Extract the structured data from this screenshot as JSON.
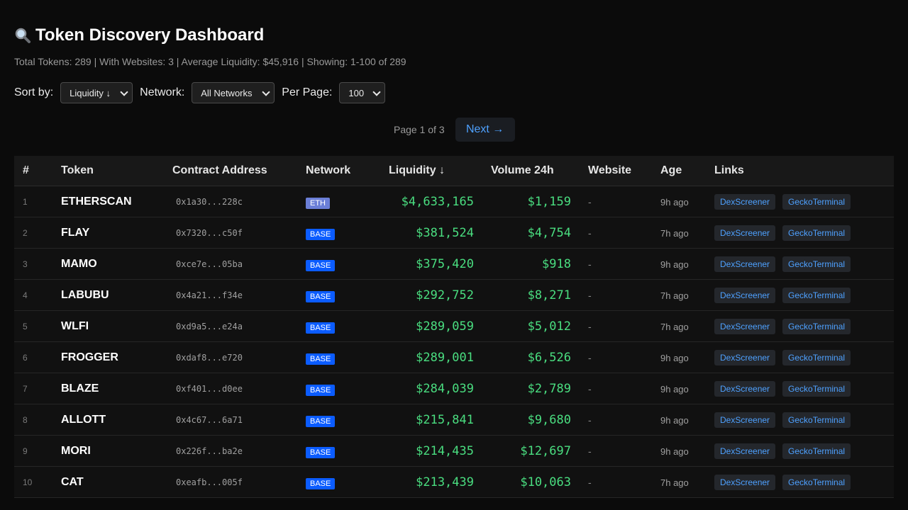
{
  "header": {
    "title": "Token Discovery Dashboard",
    "title_icon": "magnifier-icon",
    "stats": "Total Tokens: 289 | With Websites: 3 | Average Liquidity: $45,916 | Showing: 1-100 of 289"
  },
  "controls": {
    "sort_label": "Sort by:",
    "sort_value": "Liquidity ↓",
    "network_label": "Network:",
    "network_value": "All Networks",
    "per_page_label": "Per Page:",
    "per_page_value": "100"
  },
  "pagination": {
    "info": "Page 1 of 3",
    "next_label": "Next →"
  },
  "table": {
    "columns": [
      "#",
      "Token",
      "Contract Address",
      "Network",
      "Liquidity ↓",
      "Volume 24h",
      "Website",
      "Age",
      "Links"
    ],
    "link_labels": [
      "DexScreener",
      "GeckoTerminal"
    ],
    "colors": {
      "ETH": "#6b7fd7",
      "BASE": "#0b5cff",
      "positive": "#4ade80",
      "link": "#4ea1ff"
    },
    "rows": [
      {
        "num": "1",
        "token": "ETHERSCAN",
        "address": "0x1a30...228c",
        "network": "ETH",
        "liquidity": "$4,633,165",
        "volume": "$1,159",
        "website": "-",
        "age": "9h ago"
      },
      {
        "num": "2",
        "token": "FLAY",
        "address": "0x7320...c50f",
        "network": "BASE",
        "liquidity": "$381,524",
        "volume": "$4,754",
        "website": "-",
        "age": "7h ago"
      },
      {
        "num": "3",
        "token": "MAMO",
        "address": "0xce7e...05ba",
        "network": "BASE",
        "liquidity": "$375,420",
        "volume": "$918",
        "website": "-",
        "age": "9h ago"
      },
      {
        "num": "4",
        "token": "LABUBU",
        "address": "0x4a21...f34e",
        "network": "BASE",
        "liquidity": "$292,752",
        "volume": "$8,271",
        "website": "-",
        "age": "7h ago"
      },
      {
        "num": "5",
        "token": "WLFI",
        "address": "0xd9a5...e24a",
        "network": "BASE",
        "liquidity": "$289,059",
        "volume": "$5,012",
        "website": "-",
        "age": "7h ago"
      },
      {
        "num": "6",
        "token": "FROGGER",
        "address": "0xdaf8...e720",
        "network": "BASE",
        "liquidity": "$289,001",
        "volume": "$6,526",
        "website": "-",
        "age": "9h ago"
      },
      {
        "num": "7",
        "token": "BLAZE",
        "address": "0xf401...d0ee",
        "network": "BASE",
        "liquidity": "$284,039",
        "volume": "$2,789",
        "website": "-",
        "age": "9h ago"
      },
      {
        "num": "8",
        "token": "ALLOTT",
        "address": "0x4c67...6a71",
        "network": "BASE",
        "liquidity": "$215,841",
        "volume": "$9,680",
        "website": "-",
        "age": "9h ago"
      },
      {
        "num": "9",
        "token": "MORI",
        "address": "0x226f...ba2e",
        "network": "BASE",
        "liquidity": "$214,435",
        "volume": "$12,697",
        "website": "-",
        "age": "9h ago"
      },
      {
        "num": "10",
        "token": "CAT",
        "address": "0xeafb...005f",
        "network": "BASE",
        "liquidity": "$213,439",
        "volume": "$10,063",
        "website": "-",
        "age": "7h ago"
      }
    ]
  }
}
